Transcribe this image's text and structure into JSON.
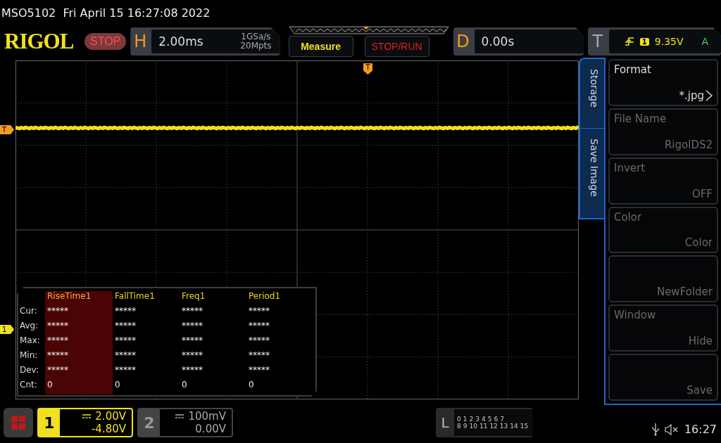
{
  "title_line": "MSO5102  Fri April 15 16:27:08 2022",
  "header": {
    "logo": "RIGOL",
    "run_state": {
      "label": "STOP",
      "kind": "stop"
    },
    "horizontal": {
      "letter": "H",
      "timebase": "2.00ms",
      "sample_rate": "1GSa/s",
      "memory_depth": "20Mpts"
    },
    "buttons": [
      {
        "label": "Measure",
        "kind": "measure"
      },
      {
        "label": "STOP/RUN",
        "kind": "stoprun"
      }
    ],
    "delay": {
      "letter": "D",
      "value": "0.00s"
    },
    "trigger": {
      "letter": "T",
      "channel": "1",
      "level": "9.35V",
      "mode": "A"
    }
  },
  "screen": {
    "trigger_position_marker": "T",
    "trigger_level_marker": "T",
    "channel_marker": "1",
    "measurements": {
      "columns": [
        {
          "label": "RiseTime1",
          "selected": true
        },
        {
          "label": "FallTime1",
          "selected": false
        },
        {
          "label": "Freq1",
          "selected": false
        },
        {
          "label": "Period1",
          "selected": false
        }
      ],
      "rows": [
        {
          "label": "Cur:",
          "values": [
            "*****",
            "*****",
            "*****",
            "*****"
          ]
        },
        {
          "label": "Avg:",
          "values": [
            "*****",
            "*****",
            "*****",
            "*****"
          ]
        },
        {
          "label": "Max:",
          "values": [
            "*****",
            "*****",
            "*****",
            "*****"
          ]
        },
        {
          "label": "Min:",
          "values": [
            "*****",
            "*****",
            "*****",
            "*****"
          ]
        },
        {
          "label": "Dev:",
          "values": [
            "*****",
            "*****",
            "*****",
            "*****"
          ]
        },
        {
          "label": "Cnt:",
          "values": [
            "0",
            "0",
            "0",
            "0"
          ]
        }
      ]
    }
  },
  "menu": {
    "tabs": [
      {
        "label": "Storage"
      },
      {
        "label": "Save Image"
      }
    ],
    "items": [
      {
        "label": "Format",
        "value": "*.jpg",
        "disabled": false,
        "submenu": true
      },
      {
        "label": "File Name",
        "value": "RigolDS2",
        "disabled": true,
        "submenu": false
      },
      {
        "label": "Invert",
        "value": "OFF",
        "disabled": true,
        "submenu": false
      },
      {
        "label": "Color",
        "value": "Color",
        "disabled": true,
        "submenu": false
      },
      {
        "value": "NewFolder",
        "disabled": true,
        "submenu": false
      },
      {
        "label": "Window",
        "value": "Hide",
        "disabled": true,
        "submenu": false
      },
      {
        "value": "Save",
        "disabled": true,
        "submenu": false
      }
    ]
  },
  "channels": [
    {
      "number": "1",
      "scale": "2.00V",
      "offset": "-4.80V",
      "active": true
    },
    {
      "number": "2",
      "scale": "100mV",
      "offset": "0.00V",
      "active": false
    }
  ],
  "logic": {
    "letter": "L",
    "row1": [
      "0",
      "1",
      "2",
      "3",
      "4",
      "5",
      "6",
      "7"
    ],
    "row2": [
      "8",
      "9",
      "10",
      "11",
      "12",
      "13",
      "14",
      "15"
    ]
  },
  "status": {
    "time": "16:27"
  }
}
